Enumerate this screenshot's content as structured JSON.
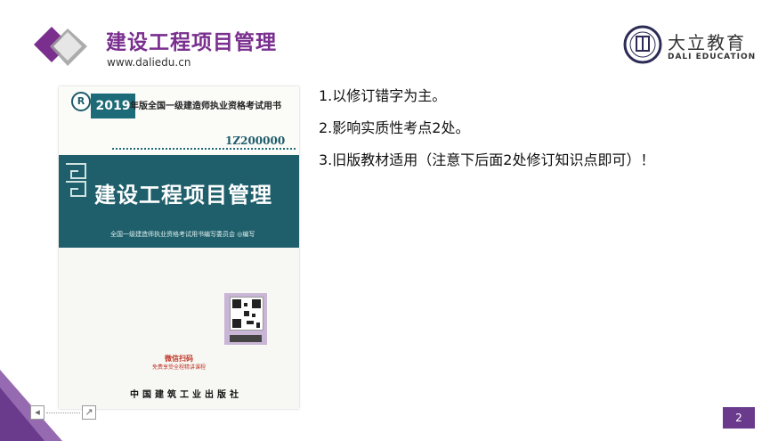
{
  "header": {
    "title": "建设工程项目管理",
    "url": "www.daliedu.cn"
  },
  "brand": {
    "name": "大立教育",
    "english": "DALI EDUCATION"
  },
  "book": {
    "logo_mark": "R",
    "year": "2019",
    "series": "年版全国一级建造师执业资格考试用书",
    "code": "1Z200000",
    "title": "建设工程项目管理",
    "editor": "全国一级建造师执业资格考试用书编写委员会 ◎编写",
    "wechat_scan": "微信扫码",
    "wechat_sub": "免费享受全程精讲课程",
    "publisher": "中国建筑工业出版社"
  },
  "points": [
    "1.以修订错字为主。",
    "2.影响实质性考点2处。",
    "3.旧版教材适用（注意下后面2处修订知识点即可）！"
  ],
  "footer": {
    "page_number": "2",
    "prev_symbol": "◂",
    "next_symbol": "↗"
  },
  "colors": {
    "accent": "#7a2f8f",
    "book_band": "#1f5f6b",
    "page_badge": "#6a3a8c"
  }
}
